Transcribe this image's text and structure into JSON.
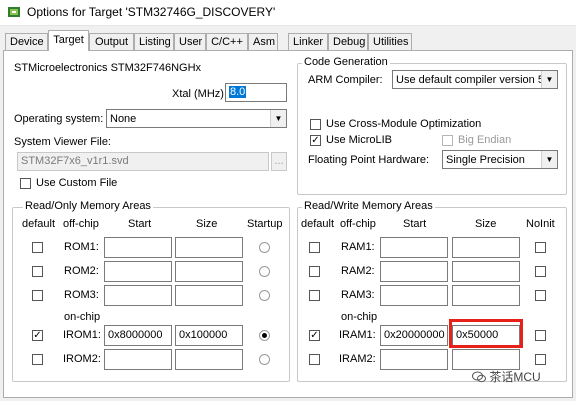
{
  "window": {
    "title": "Options for Target 'STM32746G_DISCOVERY'"
  },
  "tabs": [
    "Device",
    "Target",
    "Output",
    "Listing",
    "User",
    "C/C++",
    "Asm",
    "Linker",
    "Debug",
    "Utilities"
  ],
  "target": {
    "device_name": "STMicroelectronics STM32F746NGHx",
    "xtal_label": "Xtal (MHz):",
    "xtal_value": "8.0",
    "os_label": "Operating system:",
    "os_value": "None",
    "svf_label": "System Viewer File:",
    "svf_value": "STM32F7x6_v1r1.svd",
    "svf_browse": "...",
    "use_custom_file_label": "Use Custom File"
  },
  "codegen": {
    "title": "Code Generation",
    "compiler_label": "ARM Compiler:",
    "compiler_value": "Use default compiler version 5",
    "cross_module_label": "Use Cross-Module Optimization",
    "microlib_label": "Use MicroLIB",
    "big_endian_label": "Big Endian",
    "fp_label": "Floating Point Hardware:",
    "fp_value": "Single Precision"
  },
  "rom": {
    "title": "Read/Only Memory Areas",
    "headers": {
      "default": "default",
      "offchip": "off-chip",
      "start": "Start",
      "size": "Size",
      "startup": "Startup"
    },
    "onchip_label": "on-chip",
    "rows": [
      {
        "name": "ROM1:",
        "start": "",
        "size": ""
      },
      {
        "name": "ROM2:",
        "start": "",
        "size": ""
      },
      {
        "name": "ROM3:",
        "start": "",
        "size": ""
      },
      {
        "name": "IROM1:",
        "start": "0x8000000",
        "size": "0x100000"
      },
      {
        "name": "IROM2:",
        "start": "",
        "size": ""
      }
    ]
  },
  "ram": {
    "title": "Read/Write Memory Areas",
    "headers": {
      "default": "default",
      "offchip": "off-chip",
      "start": "Start",
      "size": "Size",
      "noinit": "NoInit"
    },
    "onchip_label": "on-chip",
    "rows": [
      {
        "name": "RAM1:",
        "start": "",
        "size": ""
      },
      {
        "name": "RAM2:",
        "start": "",
        "size": ""
      },
      {
        "name": "RAM3:",
        "start": "",
        "size": ""
      },
      {
        "name": "IRAM1:",
        "start": "0x20000000",
        "size": "0x50000"
      },
      {
        "name": "IRAM2:",
        "start": "",
        "size": ""
      }
    ]
  },
  "watermark": "茶话MCU",
  "colors": {
    "highlight": "#e8201a",
    "selection": "#0078d7"
  },
  "icons": {
    "title_icon": "keil-target-icon",
    "check": "✓",
    "dropdown": "▼"
  }
}
